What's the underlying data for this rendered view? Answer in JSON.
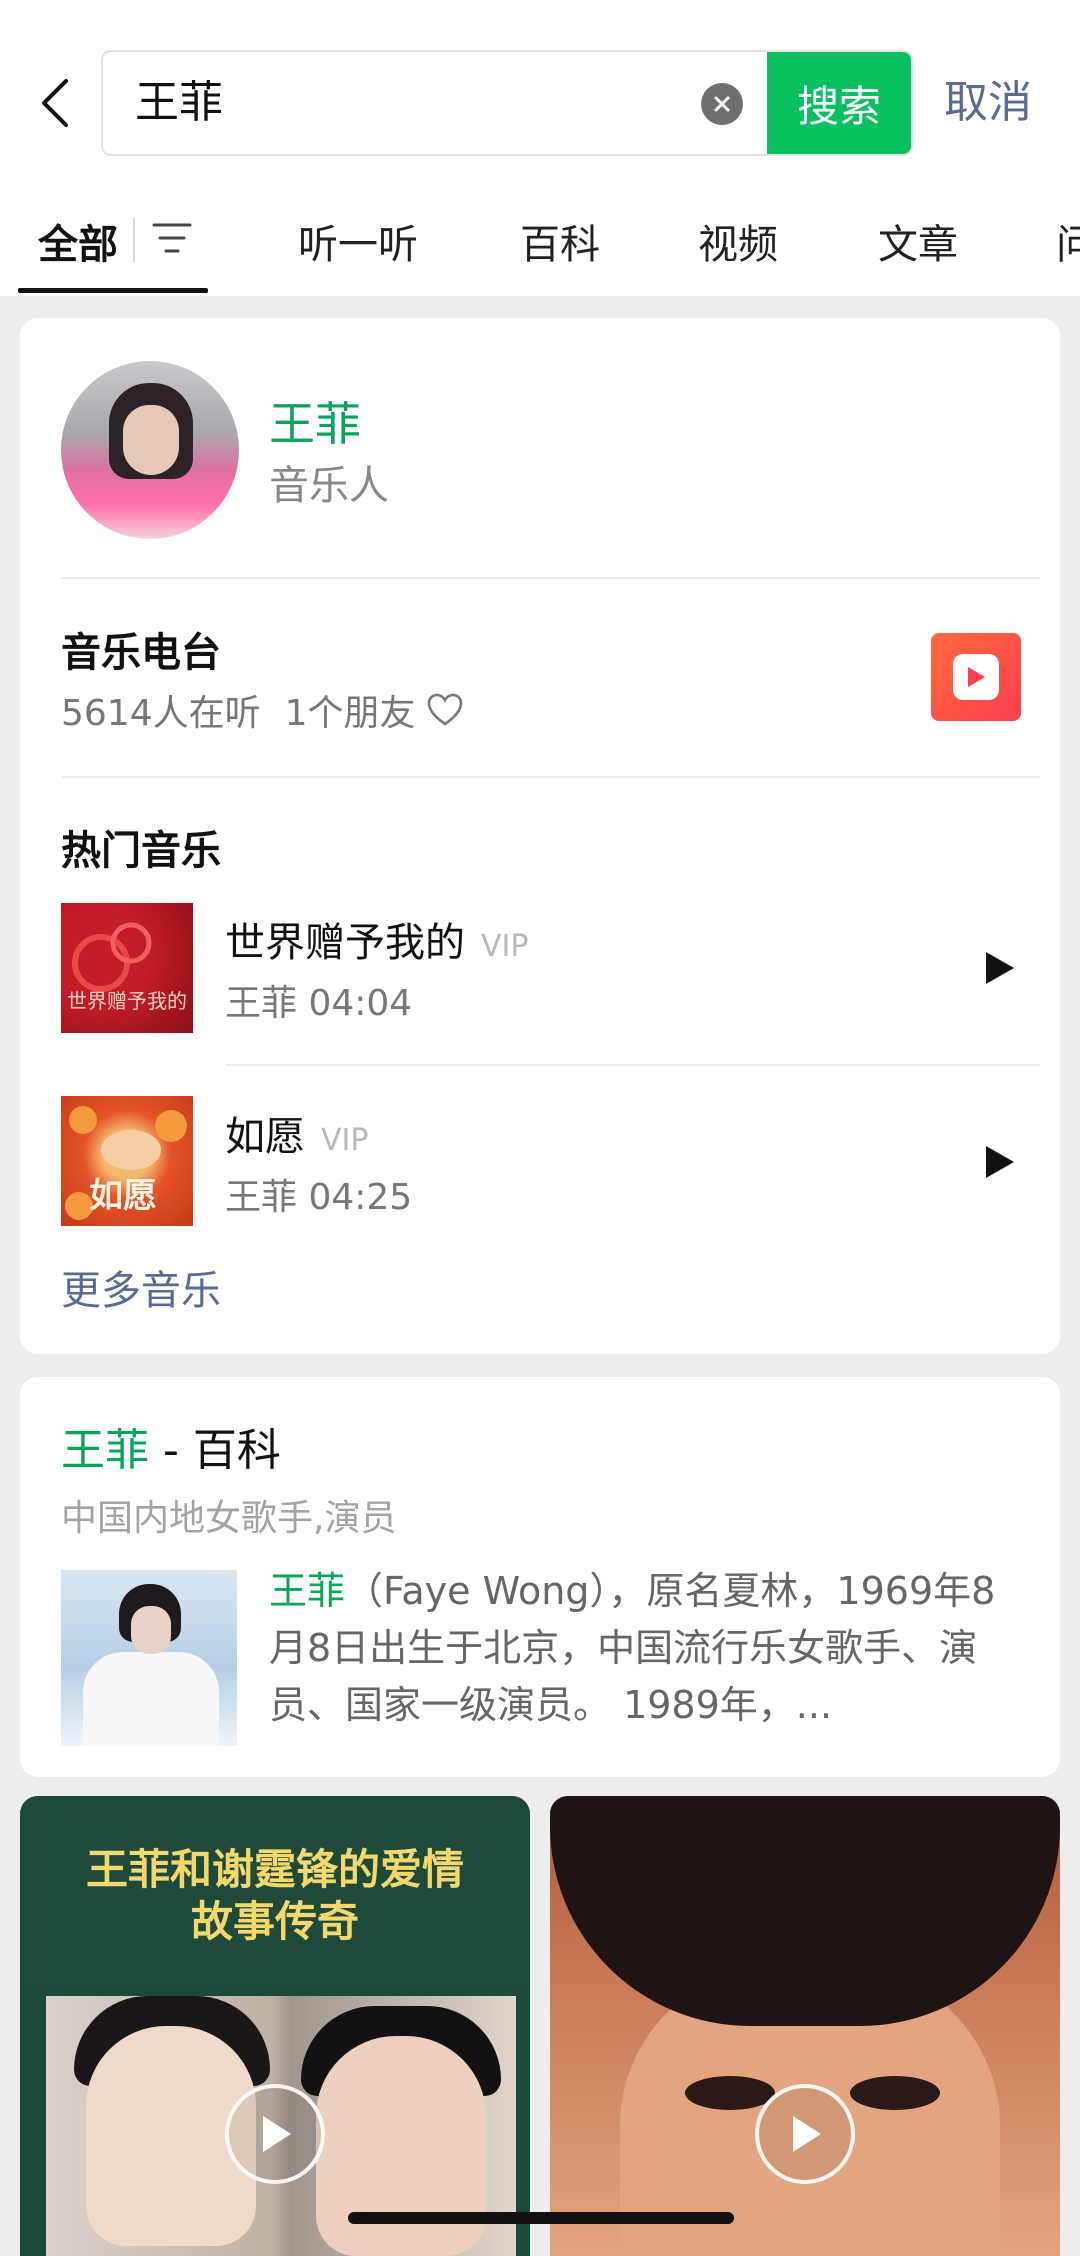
{
  "search": {
    "query": "王菲",
    "search_button": "搜索",
    "cancel": "取消"
  },
  "tabs": [
    {
      "label": "全部",
      "active": true
    },
    {
      "label": "听一听"
    },
    {
      "label": "百科"
    },
    {
      "label": "视频"
    },
    {
      "label": "文章"
    },
    {
      "label": "问"
    }
  ],
  "artist": {
    "name": "王菲",
    "role": "音乐人"
  },
  "radio": {
    "title": "音乐电台",
    "listeners": "5614人在听",
    "friends": "1个朋友"
  },
  "hot_music": {
    "title": "热门音乐",
    "songs": [
      {
        "title": "世界赠予我的",
        "badge": "VIP",
        "artist_duration": "王菲  04:04",
        "cover_text": "世界赠予我的"
      },
      {
        "title": "如愿",
        "badge": "VIP",
        "artist_duration": "王菲  04:25",
        "cover_text": "如愿"
      }
    ],
    "more": "更多音乐"
  },
  "baike": {
    "title_name": "王菲",
    "title_suffix": " - 百科",
    "subtitle": "中国内地女歌手,演员",
    "desc_name": "王菲",
    "desc_rest": "（Faye Wong），原名夏林，1969年8月8日出生于北京，中国流行乐女歌手、演员、国家一级演员。 1989年，..."
  },
  "videos": [
    {
      "title_line1": "王菲和谢霆锋的爱情",
      "title_line2": "故事传奇"
    },
    {}
  ],
  "colors": {
    "accent_green": "#07c160",
    "link_blue": "#576b95",
    "background": "#ededed"
  }
}
